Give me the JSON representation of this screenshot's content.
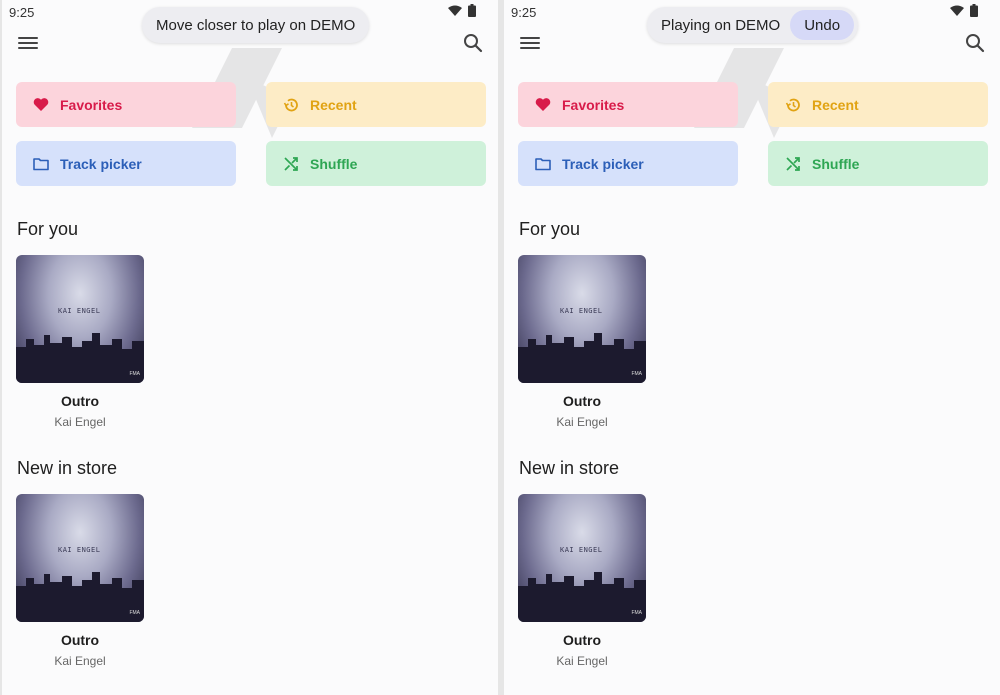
{
  "status": {
    "time": "9:25"
  },
  "left": {
    "toast": "Move closer to play on DEMO"
  },
  "right": {
    "toast": "Playing on DEMO",
    "undo": "Undo"
  },
  "chips": {
    "favorites": "Favorites",
    "recent": "Recent",
    "track_picker": "Track picker",
    "shuffle": "Shuffle"
  },
  "sections": {
    "for_you": "For you",
    "new_in_store": "New in store"
  },
  "album": {
    "title": "Outro",
    "artist": "Kai Engel",
    "cover_text": "KAI ENGEL",
    "cover_logo": "FMA"
  },
  "colors": {
    "favorites": "#d81b4a",
    "recent": "#e1a313",
    "track_picker": "#2c5fb8",
    "shuffle": "#2ea653"
  },
  "icons": [
    "menu-icon",
    "search-icon",
    "heart-icon",
    "history-icon",
    "folder-icon",
    "shuffle-icon",
    "wifi-icon",
    "battery-icon"
  ]
}
